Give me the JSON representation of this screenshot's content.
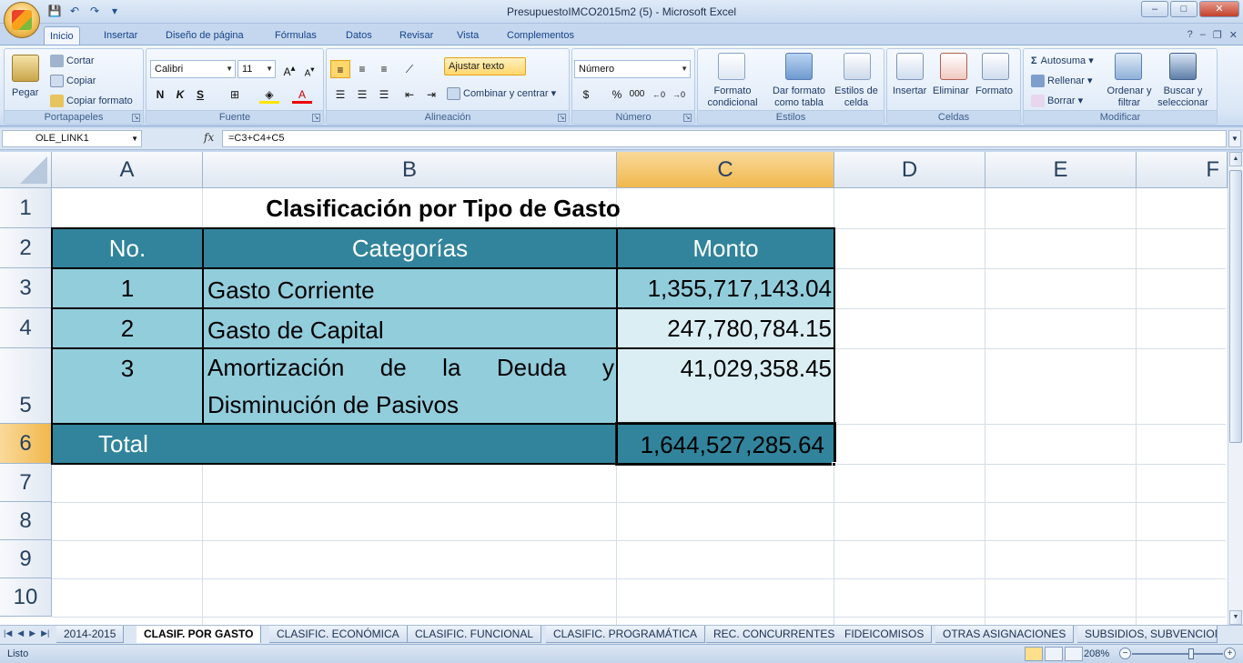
{
  "window": {
    "title": "PresupuestoIMCO2015m2 (5) - Microsoft Excel",
    "controls": {
      "minimize": "–",
      "maximize": "□",
      "close": "✕"
    }
  },
  "ribbon_tabs": [
    "Inicio",
    "Insertar",
    "Diseño de página",
    "Fórmulas",
    "Datos",
    "Revisar",
    "Vista",
    "Complementos"
  ],
  "ribbon": {
    "portapapeles": {
      "label": "Portapapeles",
      "pegar": "Pegar",
      "cortar": "Cortar",
      "copiar": "Copiar",
      "copiar_formato": "Copiar formato"
    },
    "fuente": {
      "label": "Fuente",
      "font": "Calibri",
      "size": "11",
      "bold": "N",
      "italic": "K",
      "underline": "S"
    },
    "alineacion": {
      "label": "Alineación",
      "ajustar_texto": "Ajustar texto",
      "combinar": "Combinar y centrar"
    },
    "numero": {
      "label": "Número",
      "format": "Número",
      "currency": "$",
      "percent": "%",
      "thousands": "000"
    },
    "estilos": {
      "label": "Estilos",
      "formato_condicional": "Formato condicional",
      "dar_formato": "Dar formato como tabla",
      "estilos_celda": "Estilos de celda"
    },
    "celdas": {
      "label": "Celdas",
      "insertar": "Insertar",
      "eliminar": "Eliminar",
      "formato": "Formato"
    },
    "modificar": {
      "label": "Modificar",
      "autosuma": "Autosuma",
      "rellenar": "Rellenar",
      "borrar": "Borrar",
      "ordenar": "Ordenar y filtrar",
      "buscar": "Buscar y seleccionar"
    }
  },
  "formula_bar": {
    "name_box": "OLE_LINK1",
    "fx": "fx",
    "formula": "=C3+C4+C5"
  },
  "columns": [
    "A",
    "B",
    "C",
    "D",
    "E",
    "F"
  ],
  "rows": [
    "1",
    "2",
    "3",
    "4",
    "5",
    "6",
    "7",
    "8",
    "9",
    "10"
  ],
  "sheet": {
    "title": "Clasificación por Tipo de Gasto",
    "headers": {
      "no": "No.",
      "categorias": "Categorías",
      "monto": "Monto"
    },
    "items": [
      {
        "no": "1",
        "categoria": "Gasto Corriente",
        "monto": "1,355,717,143.04"
      },
      {
        "no": "2",
        "categoria": "Gasto de Capital",
        "monto": "247,780,784.15"
      },
      {
        "no": "3",
        "categoria_line1": "Amortización de la Deuda y",
        "categoria_line2": "Disminución de Pasivos",
        "monto": "41,029,358.45"
      }
    ],
    "total_label": "Total",
    "total_value": "1,644,527,285.64"
  },
  "sheet_tabs": [
    "2014-2015",
    "CLASIF. POR GASTO",
    "CLASIFIC. ECONÓMICA",
    "CLASIFIC. FUNCIONAL",
    "CLASIFIC. PROGRAMÁTICA",
    "REC. CONCURRENTES",
    "FIDEICOMISOS",
    "OTRAS ASIGNACIONES",
    "SUBSIDIOS, SUBVENCION"
  ],
  "status": {
    "text": "Listo",
    "zoom": "208%"
  }
}
